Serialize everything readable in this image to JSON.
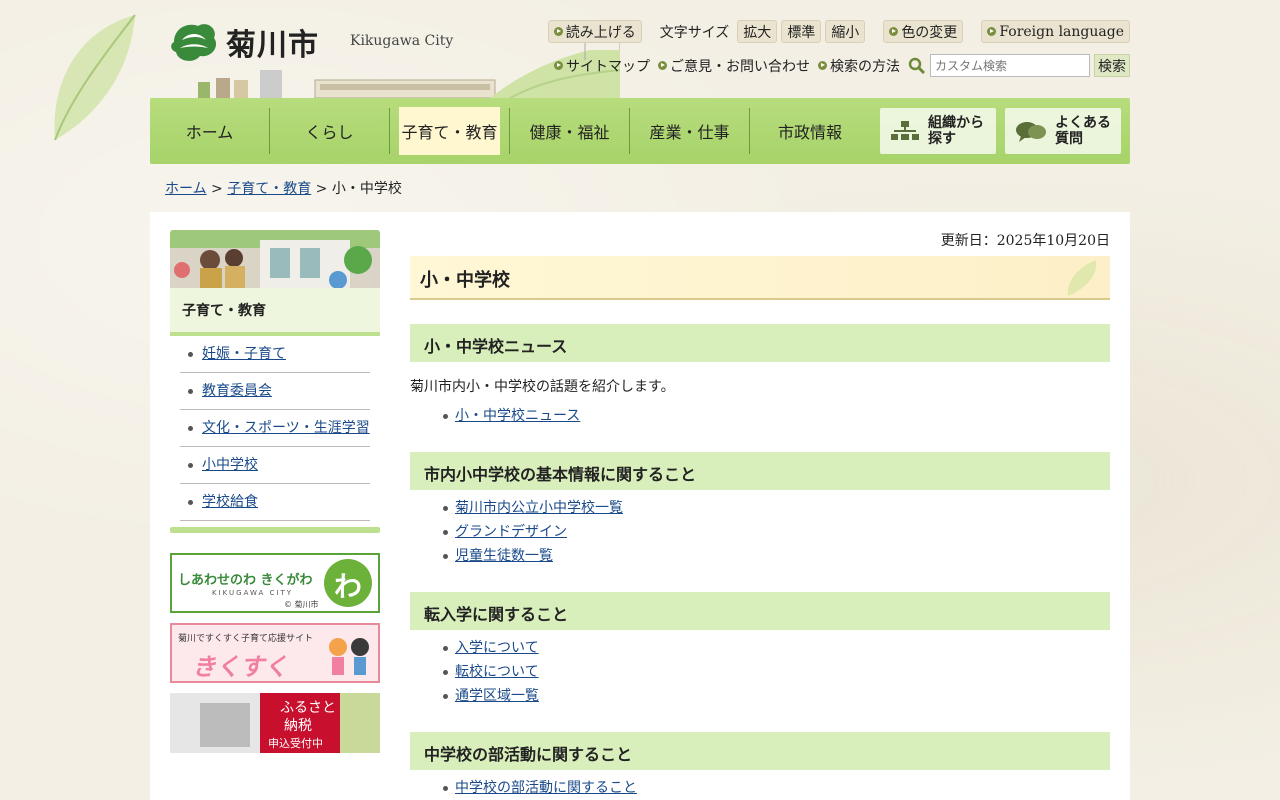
{
  "header": {
    "logo_title": "菊川市",
    "logo_sub": "Kikugawa City",
    "read_aloud": "読み上げる",
    "font_size_label": "文字サイズ",
    "font_large": "拡大",
    "font_standard": "標準",
    "font_small": "縮小",
    "color_change": "色の変更",
    "foreign_language": "Foreign language",
    "sitemap": "サイトマップ",
    "inquiry": "ご意見・お問い合わせ",
    "search_method": "検索の方法",
    "search_placeholder": "カスタム検索",
    "search_button": "検索"
  },
  "nav": {
    "items": [
      "ホーム",
      "くらし",
      "子育て・教育",
      "健康・福祉",
      "産業・仕事",
      "市政情報"
    ],
    "active_index": 2,
    "org_search": "組織から探す",
    "faq": "よくある質問"
  },
  "breadcrumb": {
    "home": "ホーム",
    "sep": " > ",
    "category": "子育て・教育",
    "current": "小・中学校"
  },
  "sidebar": {
    "heading": "子育て・教育",
    "items": [
      "妊娠・子育て",
      "教育委員会",
      "文化・スポーツ・生涯学習",
      "小中学校",
      "学校給食"
    ],
    "banner1": "しあわせのわ きくがわ",
    "banner1_sub": "KIKUGAWA CITY",
    "banner1_mark": "わ",
    "banner1_credit": "© 菊川市",
    "banner2_top": "菊川ですくすく子育て応援サイト",
    "banner2_main": "きくすく",
    "banner3_l1": "ふるさと",
    "banner3_l2": "納税",
    "banner3_l3": "申込受付中"
  },
  "main": {
    "updated": "更新日：2025年10月20日",
    "title": "小・中学校",
    "sections": [
      {
        "heading": "小・中学校ニュース",
        "desc": "菊川市内小・中学校の話題を紹介します。",
        "links": [
          "小・中学校ニュース"
        ]
      },
      {
        "heading": "市内小中学校の基本情報に関すること",
        "links": [
          "菊川市内公立小中学校一覧",
          "グランドデザイン",
          "児童生徒数一覧"
        ]
      },
      {
        "heading": "転入学に関すること",
        "links": [
          "入学について",
          "転校について",
          "通学区域一覧"
        ]
      },
      {
        "heading": "中学校の部活動に関すること",
        "links": [
          "中学校の部活動に関すること"
        ]
      }
    ]
  },
  "colors": {
    "nav_green": "#a7d36a",
    "section_green": "#d9efbb",
    "title_cream": "#fff7d6",
    "link_blue": "#1a4a8a"
  }
}
